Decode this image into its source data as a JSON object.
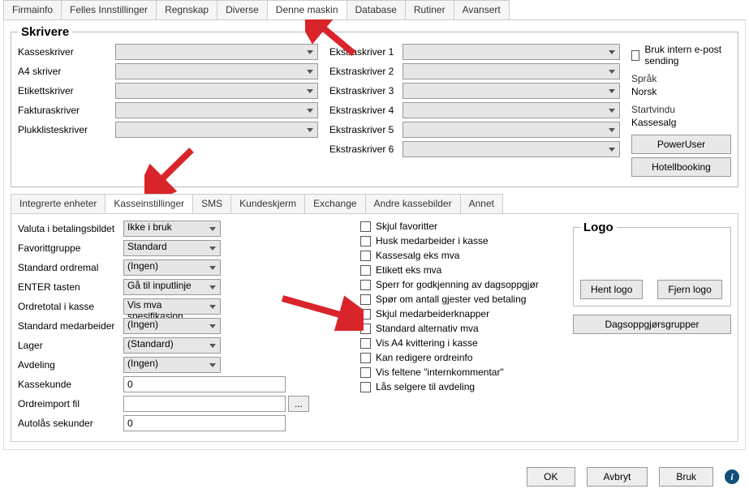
{
  "topTabs": [
    "Firmainfo",
    "Felles Innstillinger",
    "Regnskap",
    "Diverse",
    "Denne maskin",
    "Database",
    "Rutiner",
    "Avansert"
  ],
  "topActive": 4,
  "skrivere": {
    "legend": "Skrivere",
    "left": [
      {
        "label": "Kasseskriver",
        "value": ""
      },
      {
        "label": "A4 skriver",
        "value": ""
      },
      {
        "label": "Etikettskriver",
        "value": ""
      },
      {
        "label": "Fakturaskriver",
        "value": ""
      },
      {
        "label": "Plukklisteskriver",
        "value": ""
      }
    ],
    "mid": [
      {
        "label": "Ekstraskriver 1",
        "value": ""
      },
      {
        "label": "Ekstraskriver 2",
        "value": ""
      },
      {
        "label": "Ekstraskriver 3",
        "value": ""
      },
      {
        "label": "Ekstraskriver 4",
        "value": ""
      },
      {
        "label": "Ekstraskriver 5",
        "value": ""
      },
      {
        "label": "Ekstraskriver 6",
        "value": ""
      }
    ],
    "epost_label": "Bruk intern e-post sending",
    "sprak_label": "Språk",
    "sprak_value": "Norsk",
    "startvindu_label": "Startvindu",
    "startvindu_value": "Kassesalg",
    "poweruser": "PowerUser",
    "hotellbooking": "Hotellbooking"
  },
  "midTabs": [
    "Integrerte enheter",
    "Kasseinstillinger",
    "SMS",
    "Kundeskjerm",
    "Exchange",
    "Andre kassebilder",
    "Annet"
  ],
  "midActive": 1,
  "settings": {
    "rows": [
      {
        "label": "Valuta i betalingsbildet",
        "type": "select",
        "value": "Ikke i bruk"
      },
      {
        "label": "Favorittgruppe",
        "type": "select",
        "value": "Standard"
      },
      {
        "label": "Standard ordremal",
        "type": "select",
        "value": "(Ingen)"
      },
      {
        "label": "ENTER tasten",
        "type": "select",
        "value": "Gå til inputlinje"
      },
      {
        "label": "Ordretotal i kasse",
        "type": "select",
        "value": "Vis mva spesifikasjon"
      },
      {
        "label": "Standard medarbeider",
        "type": "select",
        "value": "(Ingen)"
      },
      {
        "label": "Lager",
        "type": "select",
        "value": "(Standard)"
      },
      {
        "label": "Avdeling",
        "type": "select",
        "value": "(Ingen)"
      },
      {
        "label": "Kassekunde",
        "type": "text",
        "value": "0"
      },
      {
        "label": "Ordreimport fil",
        "type": "file",
        "value": ""
      },
      {
        "label": "Autolås sekunder",
        "type": "text",
        "value": "0"
      }
    ],
    "checks": [
      "Skjul favoritter",
      "Husk medarbeider i kasse",
      "Kassesalg eks mva",
      "Etikett eks mva",
      "Sperr for godkjenning av dagsoppgjør",
      "Spør om antall gjester ved betaling",
      "Skjul medarbeiderknapper",
      "Standard alternativ mva",
      "Vis A4 kvittering i kasse",
      "Kan redigere ordreinfo",
      "Vis feltene \"internkommentar\"",
      "Lås selgere til avdeling"
    ],
    "logo_legend": "Logo",
    "hent_logo": "Hent logo",
    "fjern_logo": "Fjern logo",
    "dagsopp": "Dagsoppgjørsgrupper"
  },
  "footer": {
    "ok": "OK",
    "avbryt": "Avbryt",
    "bruk": "Bruk"
  }
}
